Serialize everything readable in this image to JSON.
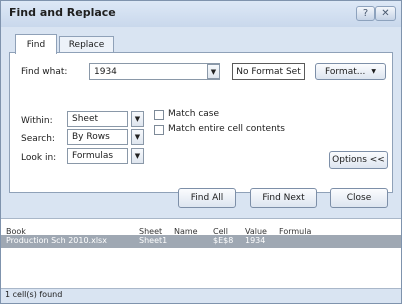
{
  "title": "Find and Replace",
  "titlebar_buttons": {
    "help": "?",
    "close": "✕"
  },
  "tabs": [
    {
      "label": "Find",
      "active": true
    },
    {
      "label": "Replace",
      "active": false
    }
  ],
  "find": {
    "label": "Find what:",
    "value": "1934",
    "format_preview": "No Format Set",
    "format_button": "Format...",
    "format_arrow": "▼"
  },
  "options": {
    "within": {
      "label": "Within:",
      "value": "Sheet"
    },
    "search": {
      "label": "Search:",
      "value": "By Rows"
    },
    "look_in": {
      "label": "Look in:",
      "value": "Formulas"
    },
    "match_case": {
      "label": "Match case",
      "checked": false
    },
    "match_entire": {
      "label": "Match entire cell contents",
      "checked": false
    },
    "options_button": "Options <<"
  },
  "dropdown_arrow": "▼",
  "buttons": {
    "find_all": "Find All",
    "find_next": "Find Next",
    "close": "Close"
  },
  "results": {
    "columns": [
      "Book",
      "Sheet",
      "Name",
      "Cell",
      "Value",
      "Formula"
    ],
    "rows": [
      {
        "book": "Production Sch 2010.xlsx",
        "sheet": "Sheet1",
        "name": "",
        "cell": "$E$8",
        "value": "1934",
        "formula": ""
      }
    ]
  },
  "status": "1 cell(s) found",
  "colors": {
    "titlebar": "#dde8f6",
    "selected_row": "#9fa8b3",
    "dialog_bg": "#d9e4f2"
  }
}
